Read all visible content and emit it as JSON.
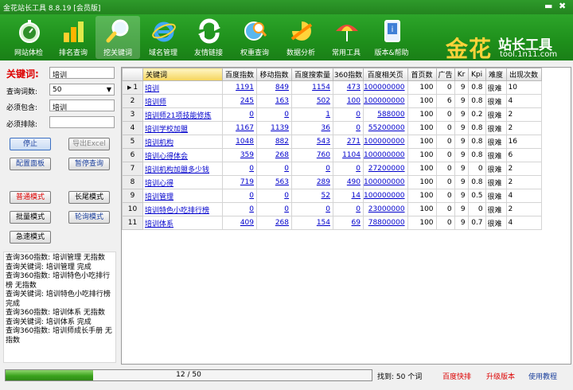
{
  "window": {
    "title": "金花站长工具 8.8.19 [会员版]",
    "min_glyph": "▬",
    "close_glyph": "✖"
  },
  "toolbar": [
    {
      "label": "网站体检",
      "icon": "stopwatch-icon"
    },
    {
      "label": "排名查询",
      "icon": "bar-chart-icon"
    },
    {
      "label": "挖关键词",
      "icon": "magnifier-icon",
      "active": true
    },
    {
      "label": "域名管理",
      "icon": "ie-icon"
    },
    {
      "label": "友情链接",
      "icon": "refresh-arrows-icon"
    },
    {
      "label": "权重查询",
      "icon": "globe-magnifier-icon"
    },
    {
      "label": "数据分析",
      "icon": "pie-arrow-icon"
    },
    {
      "label": "常用工具",
      "icon": "umbrella-icon"
    },
    {
      "label": "版本&帮助",
      "icon": "help-book-icon"
    }
  ],
  "logo": {
    "gold": "金花",
    "text": "站长工具",
    "url": "tool.1n11.com",
    "gold_color": "#ffd33a"
  },
  "left": {
    "keyword_label": "关键词:",
    "keyword_value": "培训",
    "count_label": "查询词数:",
    "count_value": "50",
    "include_label": "必须包含:",
    "include_value": "培训",
    "exclude_label": "必须排除:",
    "exclude_value": "",
    "stop": "停止",
    "export": "导出Excel",
    "config": "配置面板",
    "pause": "暂停查询",
    "normal_mode": "普通模式",
    "long_mode": "长尾模式",
    "batch_mode": "批量模式",
    "loop_mode": "轮询模式",
    "fast_mode": "急速模式"
  },
  "log": [
    "查询360指数: 培训管理 无指数",
    "查询关键词: 培训管理 完成",
    "查询360指数: 培训特色小吃排行榜 无指数",
    "查询关键词: 培训特色小吃排行榜 完成",
    "查询360指数: 培训体系 无指数",
    "查询关键词: 培训体系 完成",
    "查询360指数: 培训师成长手册 无指数"
  ],
  "table": {
    "headers": [
      "关键词",
      "百度指数",
      "移动指数",
      "百度搜索量",
      "360指数",
      "百度相关页",
      "首页数",
      "广告",
      "Kr",
      "Kpi",
      "难度",
      "出现次数"
    ],
    "current_marker": "▶",
    "rows": [
      {
        "n": "1",
        "kw": "培训",
        "bd": "1191",
        "mob": "849",
        "sv": "1154",
        "s360": "473",
        "rel": "100000000",
        "home": "100",
        "ad": "0",
        "kr": "9",
        "kpi": "0.8",
        "diff": "很难",
        "cnt": "10"
      },
      {
        "n": "2",
        "kw": "培训师",
        "bd": "245",
        "mob": "163",
        "sv": "502",
        "s360": "100",
        "rel": "100000000",
        "home": "100",
        "ad": "6",
        "kr": "9",
        "kpi": "0.8",
        "diff": "很难",
        "cnt": "4"
      },
      {
        "n": "3",
        "kw": "培训师21项技能修炼",
        "bd": "0",
        "mob": "0",
        "sv": "1",
        "s360": "0",
        "rel": "588000",
        "home": "100",
        "ad": "0",
        "kr": "9",
        "kpi": "0.2",
        "diff": "很难",
        "cnt": "2"
      },
      {
        "n": "4",
        "kw": "培训学校加盟",
        "bd": "1167",
        "mob": "1139",
        "sv": "36",
        "s360": "0",
        "rel": "55200000",
        "home": "100",
        "ad": "0",
        "kr": "9",
        "kpi": "0.8",
        "diff": "很难",
        "cnt": "2"
      },
      {
        "n": "5",
        "kw": "培训机构",
        "bd": "1048",
        "mob": "882",
        "sv": "543",
        "s360": "271",
        "rel": "100000000",
        "home": "100",
        "ad": "0",
        "kr": "9",
        "kpi": "0.8",
        "diff": "很难",
        "cnt": "16"
      },
      {
        "n": "6",
        "kw": "培训心得体会",
        "bd": "359",
        "mob": "268",
        "sv": "760",
        "s360": "1104",
        "rel": "100000000",
        "home": "100",
        "ad": "0",
        "kr": "9",
        "kpi": "0.8",
        "diff": "很难",
        "cnt": "6"
      },
      {
        "n": "7",
        "kw": "培训机构加盟多少钱",
        "bd": "0",
        "mob": "0",
        "sv": "0",
        "s360": "0",
        "rel": "27200000",
        "home": "100",
        "ad": "0",
        "kr": "9",
        "kpi": "0",
        "diff": "很难",
        "cnt": "2"
      },
      {
        "n": "8",
        "kw": "培训心得",
        "bd": "719",
        "mob": "563",
        "sv": "289",
        "s360": "490",
        "rel": "100000000",
        "home": "100",
        "ad": "0",
        "kr": "9",
        "kpi": "0.8",
        "diff": "很难",
        "cnt": "2"
      },
      {
        "n": "9",
        "kw": "培训管理",
        "bd": "0",
        "mob": "0",
        "sv": "52",
        "s360": "14",
        "rel": "100000000",
        "home": "100",
        "ad": "0",
        "kr": "9",
        "kpi": "0.5",
        "diff": "很难",
        "cnt": "4"
      },
      {
        "n": "10",
        "kw": "培训特色小吃排行榜",
        "bd": "0",
        "mob": "0",
        "sv": "0",
        "s360": "0",
        "rel": "23000000",
        "home": "100",
        "ad": "0",
        "kr": "9",
        "kpi": "0",
        "diff": "很难",
        "cnt": "2"
      },
      {
        "n": "11",
        "kw": "培训体系",
        "bd": "409",
        "mob": "268",
        "sv": "154",
        "s360": "69",
        "rel": "78800000",
        "home": "100",
        "ad": "0",
        "kr": "9",
        "kpi": "0.7",
        "diff": "很难",
        "cnt": "4"
      }
    ]
  },
  "status": {
    "progress_text": "12 / 50",
    "progress_fraction": 0.24,
    "found": "找到: 50 个词",
    "baidu_rank": "百度快排",
    "upgrade": "升级版本",
    "tutorial": "使用教程"
  }
}
